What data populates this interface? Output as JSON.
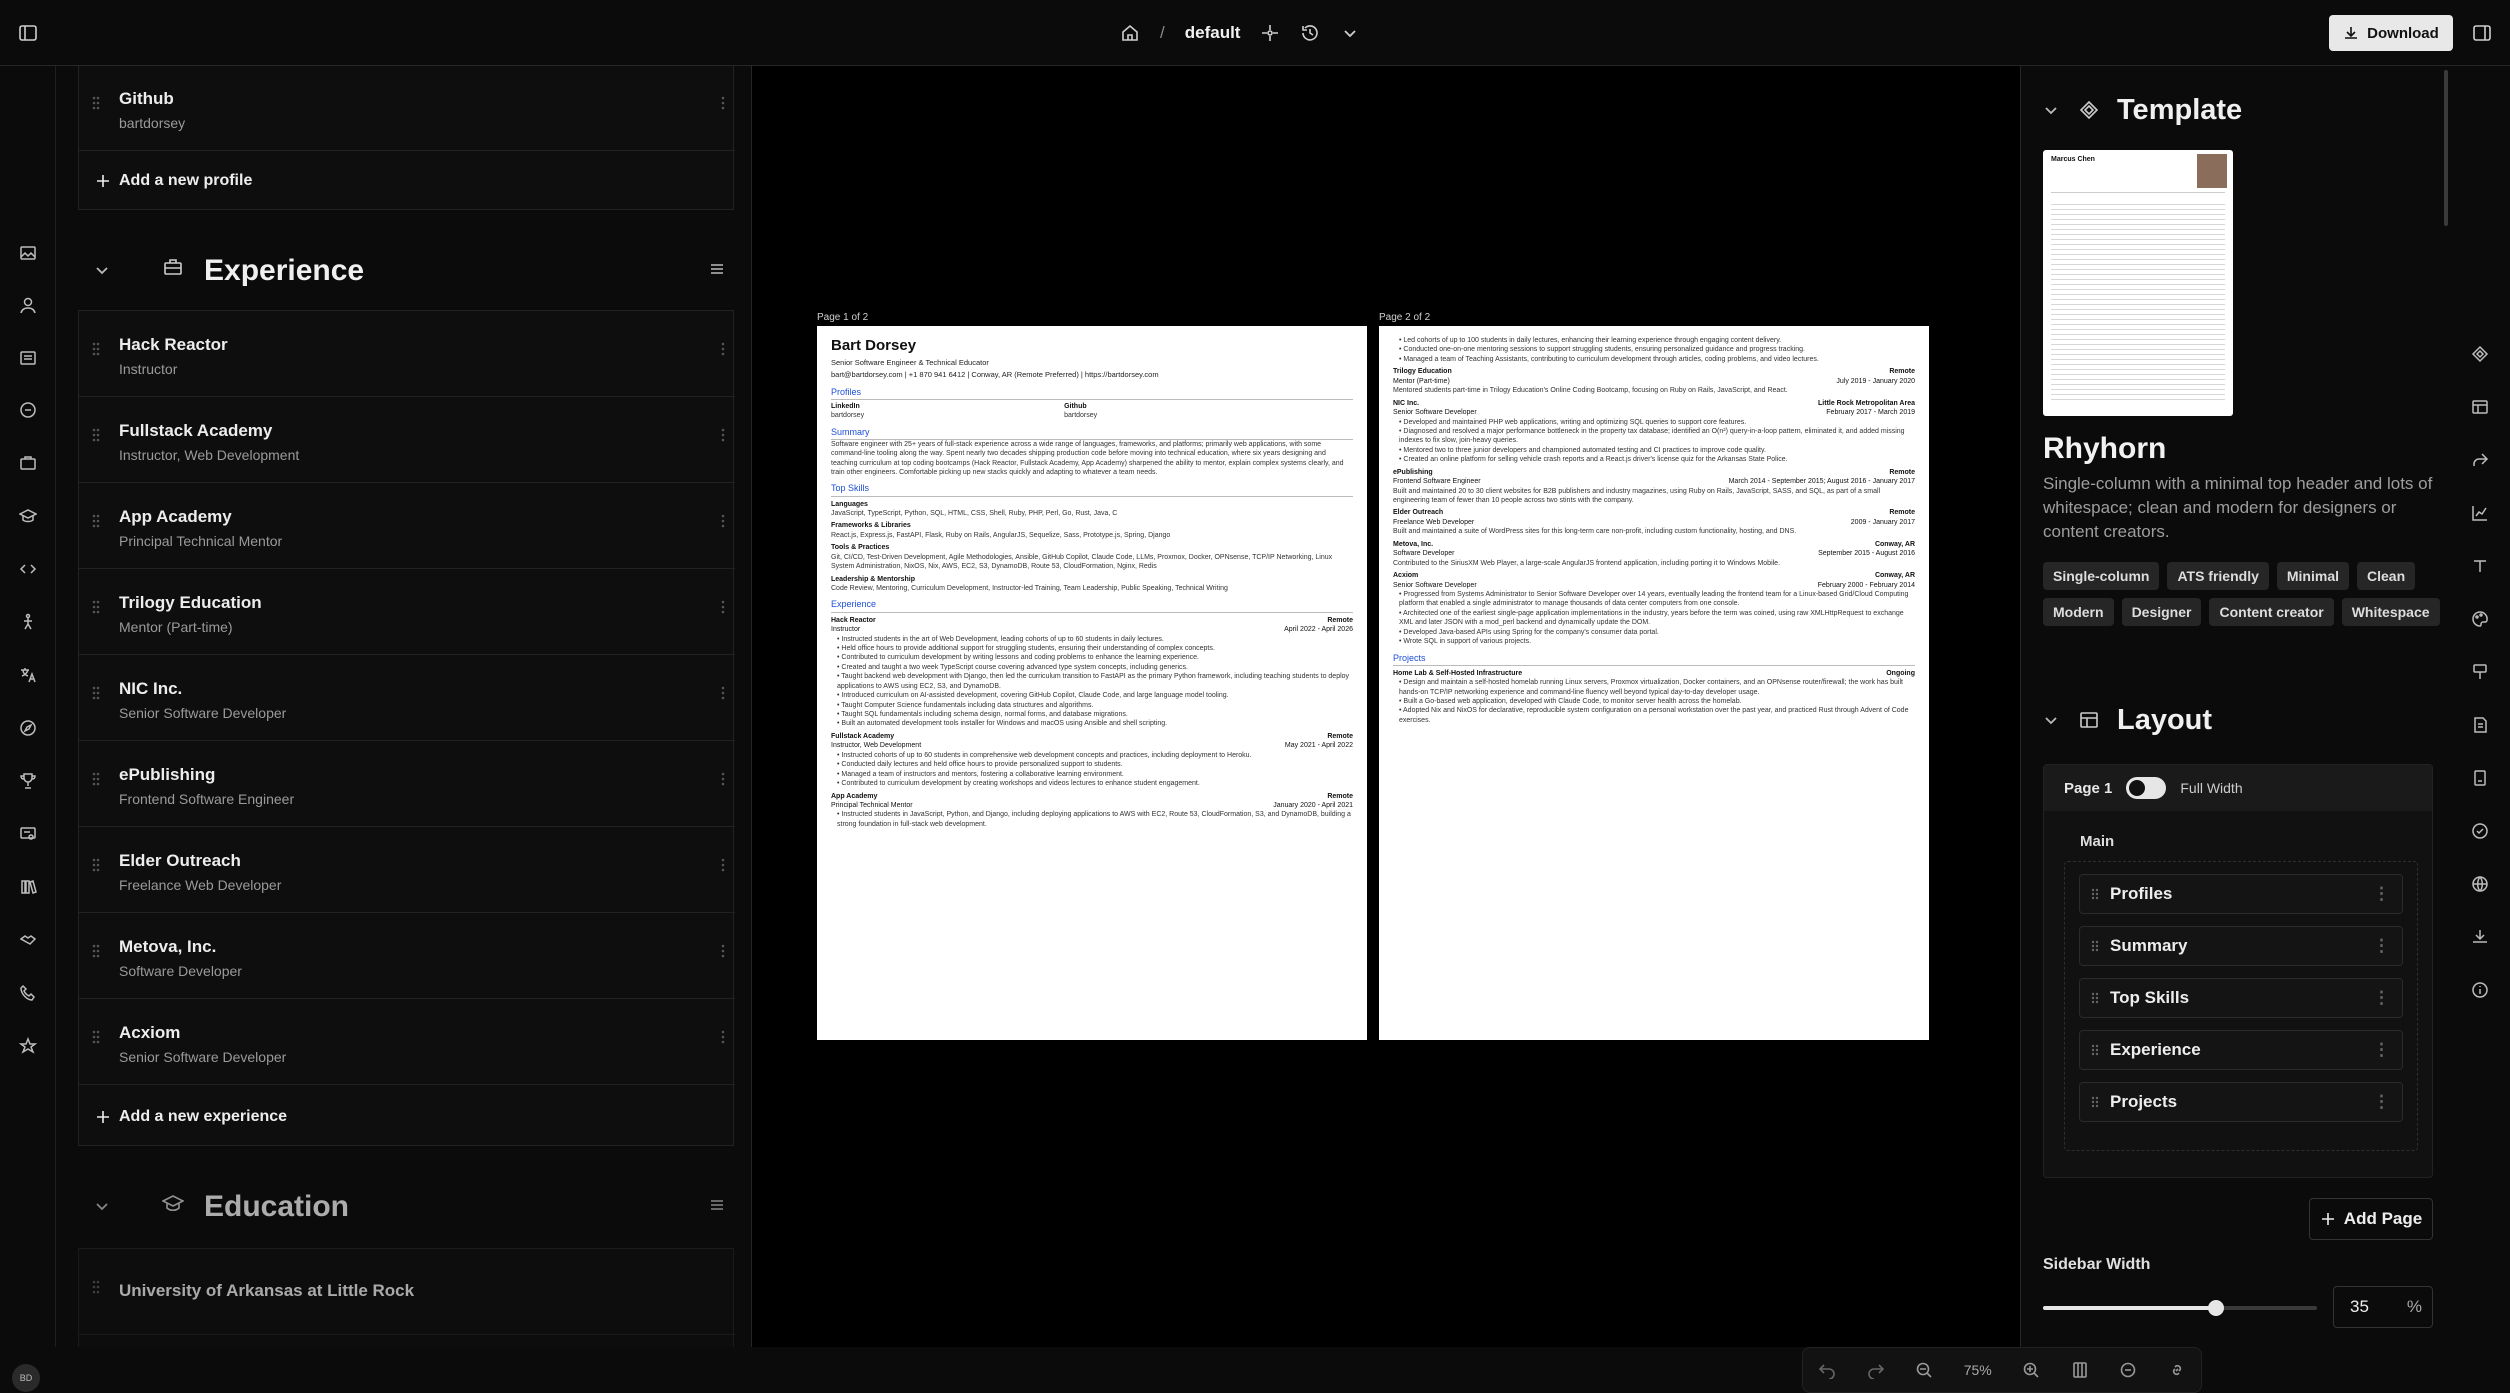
{
  "header": {
    "breadcrumb_doc": "default",
    "download_label": "Download"
  },
  "profiles": {
    "items": [
      {
        "name": "Github",
        "sub": "bartdorsey"
      }
    ],
    "add_label": "Add a new profile"
  },
  "experience": {
    "title": "Experience",
    "items": [
      {
        "company": "Hack Reactor",
        "position": "Instructor"
      },
      {
        "company": "Fullstack Academy",
        "position": "Instructor, Web Development"
      },
      {
        "company": "App Academy",
        "position": "Principal Technical Mentor"
      },
      {
        "company": "Trilogy Education",
        "position": "Mentor (Part-time)"
      },
      {
        "company": "NIC Inc.",
        "position": "Senior Software Developer"
      },
      {
        "company": "ePublishing",
        "position": "Frontend Software Engineer"
      },
      {
        "company": "Elder Outreach",
        "position": "Freelance Web Developer"
      },
      {
        "company": "Metova, Inc.",
        "position": "Software Developer"
      },
      {
        "company": "Acxiom",
        "position": "Senior Software Developer"
      }
    ],
    "add_label": "Add a new experience"
  },
  "education": {
    "title": "Education",
    "items": [
      {
        "school": "University of Arkansas at Little Rock"
      }
    ]
  },
  "canvas": {
    "page1_label": "Page 1 of 2",
    "page2_label": "Page 2 of 2",
    "zoom": "75%",
    "resume": {
      "name": "Bart Dorsey",
      "headline": "Senior Software Engineer & Technical Educator",
      "contact": "bart@bartdorsey.com | +1 870 941 6412 | Conway, AR (Remote Preferred) | https://bartdorsey.com",
      "profiles_title": "Profiles",
      "profile1": "LinkedIn",
      "profile1_user": "bartdorsey",
      "profile2": "Github",
      "profile2_user": "bartdorsey",
      "summary_title": "Summary",
      "summary": "Software engineer with 25+ years of full-stack experience across a wide range of languages, frameworks, and platforms; primarily web applications, with some command-line tooling along the way. Spent nearly two decades shipping production code before moving into technical education, where six years designing and teaching curriculum at top coding bootcamps (Hack Reactor, Fullstack Academy, App Academy) sharpened the ability to mentor, explain complex systems clearly, and train other engineers. Comfortable picking up new stacks quickly and adapting to whatever a team needs.",
      "skills_title": "Top Skills",
      "skill1": "Languages",
      "skill1_v": "JavaScript, TypeScript, Python, SQL, HTML, CSS, Shell, Ruby, PHP, Perl, Go, Rust, Java, C",
      "skill2": "Frameworks & Libraries",
      "skill2_v": "React.js, Express.js, FastAPI, Flask, Ruby on Rails, AngularJS, Sequelize, Sass, Prototype.js, Spring, Django",
      "skill3": "Tools & Practices",
      "skill3_v": "Git, CI/CD, Test-Driven Development, Agile Methodologies, Ansible, GitHub Copilot, Claude Code, LLMs, Proxmox, Docker, OPNsense, TCP/IP Networking, Linux System Administration, NixOS, Nix, AWS, EC2, S3, DynamoDB, Route 53, CloudFormation, Nginx, Redis",
      "skill4": "Leadership & Mentorship",
      "skill4_v": "Code Review, Mentoring, Curriculum Development, Instructor-led Training, Team Leadership, Public Speaking, Technical Writing",
      "exp_title": "Experience",
      "e1": "Hack Reactor",
      "e1_loc": "Remote",
      "e1_role": "Instructor",
      "e1_date": "April 2022 - April 2026",
      "e1_b": [
        "Instructed students in the art of Web Development, leading cohorts of up to 60 students in daily lectures.",
        "Held office hours to provide additional support for struggling students, ensuring their understanding of complex concepts.",
        "Contributed to curriculum development by writing lessons and coding problems to enhance the learning experience.",
        "Created and taught a two week TypeScript course covering advanced type system concepts, including generics.",
        "Taught backend web development with Django, then led the curriculum transition to FastAPI as the primary Python framework, including teaching students to deploy applications to AWS using EC2, S3, and DynamoDB.",
        "Introduced curriculum on AI-assisted development, covering GitHub Copilot, Claude Code, and large language model tooling.",
        "Taught Computer Science fundamentals including data structures and algorithms.",
        "Taught SQL fundamentals including schema design, normal forms, and database migrations.",
        "Built an automated development tools installer for Windows and macOS using Ansible and shell scripting."
      ],
      "e2": "Fullstack Academy",
      "e2_loc": "Remote",
      "e2_role": "Instructor, Web Development",
      "e2_date": "May 2021 - April 2022",
      "e2_b": [
        "Instructed cohorts of up to 60 students in comprehensive web development concepts and practices, including deployment to Heroku.",
        "Conducted daily lectures and held office hours to provide personalized support to students.",
        "Managed a team of instructors and mentors, fostering a collaborative learning environment.",
        "Contributed to curriculum development by creating workshops and videos lectures to enhance student engagement."
      ],
      "e3": "App Academy",
      "e3_loc": "Remote",
      "e3_role": "Principal Technical Mentor",
      "e3_date": "January 2020 - April 2021",
      "e3_b": [
        "Instructed students in JavaScript, Python, and Django, including deploying applications to AWS with EC2, Route 53, CloudFormation, S3, and DynamoDB, building a strong foundation in full-stack web development."
      ],
      "p2_top": [
        "Led cohorts of up to 100 students in daily lectures, enhancing their learning experience through engaging content delivery.",
        "Conducted one-on-one mentoring sessions to support struggling students, ensuring personalized guidance and progress tracking.",
        "Managed a team of Teaching Assistants, contributing to curriculum development through articles, coding problems, and video lectures."
      ],
      "e4": "Trilogy Education",
      "e4_loc": "Remote",
      "e4_role": "Mentor (Part-time)",
      "e4_date": "July 2019 - January 2020",
      "e4_desc": "Mentored students part-time in Trilogy Education's Online Coding Bootcamp, focusing on Ruby on Rails, JavaScript, and React.",
      "e5": "NIC Inc.",
      "e5_loc": "Little Rock Metropolitan Area",
      "e5_role": "Senior Software Developer",
      "e5_date": "February 2017 - March 2019",
      "e5_b": [
        "Developed and maintained PHP web applications, writing and optimizing SQL queries to support core features.",
        "Diagnosed and resolved a major performance bottleneck in the property tax database; identified an O(n²) query-in-a-loop pattern, eliminated it, and added missing indexes to fix slow, join-heavy queries.",
        "Mentored two to three junior developers and championed automated testing and CI practices to improve code quality.",
        "Created an online platform for selling vehicle crash reports and a React.js driver's license quiz for the Arkansas State Police."
      ],
      "e6": "ePublishing",
      "e6_loc": "Remote",
      "e6_role": "Frontend Software Engineer",
      "e6_date": "March 2014 - September 2015; August 2016 - January 2017",
      "e6_desc": "Built and maintained 20 to 30 client websites for B2B publishers and industry magazines, using Ruby on Rails, JavaScript, SASS, and SQL, as part of a small engineering team of fewer than 10 people across two stints with the company.",
      "e7": "Elder Outreach",
      "e7_loc": "Remote",
      "e7_role": "Freelance Web Developer",
      "e7_date": "2009 - January 2017",
      "e7_desc": "Built and maintained a suite of WordPress sites for this long-term care non-profit, including custom functionality, hosting, and DNS.",
      "e8": "Metova, Inc.",
      "e8_loc": "Conway, AR",
      "e8_role": "Software Developer",
      "e8_date": "September 2015 - August 2016",
      "e8_desc": "Contributed to the SiriusXM Web Player, a large-scale AngularJS frontend application, including porting it to Windows Mobile.",
      "e9": "Acxiom",
      "e9_loc": "Conway, AR",
      "e9_role": "Senior Software Developer",
      "e9_date": "February 2000 - February 2014",
      "e9_b": [
        "Progressed from Systems Administrator to Senior Software Developer over 14 years, eventually leading the frontend team for a Linux-based Grid/Cloud Computing platform that enabled a single administrator to manage thousands of data center computers from one console.",
        "Architected one of the earliest single-page application implementations in the industry, years before the term was coined, using raw XMLHttpRequest to exchange XML and later JSON with a mod_perl backend and dynamically update the DOM.",
        "Developed Java-based APIs using Spring for the company's consumer data portal.",
        "Wrote SQL in support of various projects."
      ],
      "proj_title": "Projects",
      "pr1": "Home Lab & Self-Hosted Infrastructure",
      "pr1_date": "Ongoing",
      "pr1_b": [
        "Design and maintain a self-hosted homelab running Linux servers, Proxmox virtualization, Docker containers, and an OPNsense router/firewall; the work has built hands-on TCP/IP networking experience and command-line fluency well beyond typical day-to-day developer usage.",
        "Built a Go-based web application, developed with Claude Code, to monitor server health across the homelab.",
        "Adopted Nix and NixOS for declarative, reproducible system configuration on a personal workstation over the past year, and practiced Rust through Advent of Code exercises."
      ]
    }
  },
  "template": {
    "title": "Template",
    "name": "Rhyhorn",
    "description": "Single-column with a minimal top header and lots of whitespace; clean and modern for designers or content creators.",
    "tags": [
      "Single-column",
      "ATS friendly",
      "Minimal",
      "Clean",
      "Modern",
      "Designer",
      "Content creator",
      "Whitespace"
    ],
    "thumb_name": "Marcus Chen"
  },
  "layout": {
    "title": "Layout",
    "page_label": "Page 1",
    "full_width_label": "Full Width",
    "full_width_on": true,
    "main_label": "Main",
    "main_items": [
      "Profiles",
      "Summary",
      "Top Skills",
      "Experience",
      "Projects"
    ],
    "add_page_label": "Add Page",
    "sidebar_width_label": "Sidebar Width",
    "sidebar_width": "35",
    "sidebar_width_fraction": 0.35,
    "percent_sign": "%"
  },
  "user": {
    "initials": "BD"
  },
  "colors": {
    "accent_link": "#1d4ed8",
    "background": "#0b0b0b"
  }
}
